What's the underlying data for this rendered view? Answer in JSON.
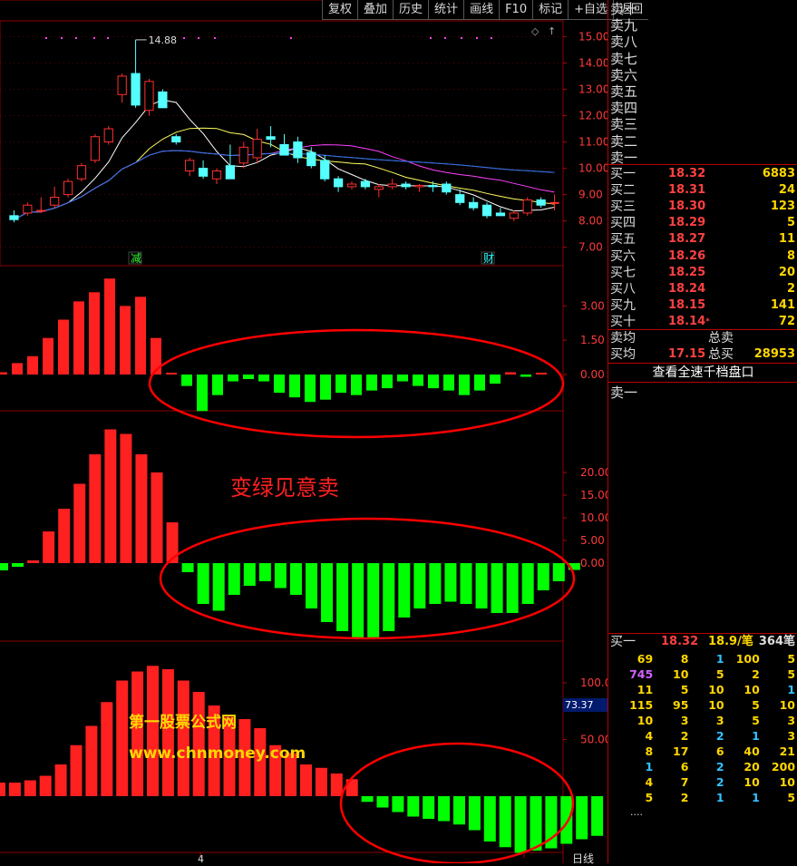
{
  "toolbar": {
    "items": [
      "复权",
      "叠加",
      "历史",
      "统计",
      "画线",
      "F10",
      "标记",
      "+自选",
      "返回"
    ]
  },
  "price_panel": {
    "high_label": "14.88",
    "y_ticks": [
      "15.00",
      "14.00",
      "13.00",
      "12.00",
      "11.00",
      "10.00",
      "9.00",
      "8.00",
      "7.00"
    ],
    "event_markers": [
      "减",
      "财"
    ]
  },
  "indicator1": {
    "y_ticks": [
      "3.00",
      "1.50",
      "0.00"
    ]
  },
  "indicator2": {
    "y_ticks": [
      "20.00",
      "15.00",
      "10.00",
      "5.00",
      "0.00"
    ],
    "annotation": "变绿见意卖"
  },
  "indicator3": {
    "y_ticks": [
      "100.0",
      "50.00"
    ],
    "current_value": "73.37"
  },
  "watermark": {
    "line1": "第一股票公式网",
    "line2": "www.chnmoney.com"
  },
  "x_axis": {
    "label": "4",
    "period": "日线"
  },
  "colors": {
    "up": "#ff2020",
    "down": "#00ff00",
    "up_candle": "#ff3030",
    "down_candle": "#55ffff",
    "circle": "#ff0000",
    "grid": "#8b0000"
  },
  "order_book": {
    "asks": [
      "卖十",
      "卖九",
      "卖八",
      "卖七",
      "卖六",
      "卖五",
      "卖四",
      "卖三",
      "卖二",
      "卖一"
    ],
    "bids": [
      {
        "label": "买一",
        "price": "18.32",
        "vol": "6883"
      },
      {
        "label": "买二",
        "price": "18.31",
        "vol": "24"
      },
      {
        "label": "买三",
        "price": "18.30",
        "vol": "123"
      },
      {
        "label": "买四",
        "price": "18.29",
        "vol": "5"
      },
      {
        "label": "买五",
        "price": "18.27",
        "vol": "11"
      },
      {
        "label": "买六",
        "price": "18.26",
        "vol": "8"
      },
      {
        "label": "买七",
        "price": "18.25",
        "vol": "20"
      },
      {
        "label": "买八",
        "price": "18.24",
        "vol": "2"
      },
      {
        "label": "买九",
        "price": "18.15",
        "vol": "141"
      },
      {
        "label": "买十",
        "price": "18.14",
        "vol": "72",
        "flag": "*"
      }
    ],
    "sell_avg_label": "卖均",
    "sell_total_label": "总卖",
    "buy_avg_label": "买均",
    "buy_avg": "17.15",
    "buy_total_label": "总买",
    "buy_total": "28953",
    "full_depth_button": "查看全速千档盘口",
    "level1_label": "卖一"
  },
  "tick_queue": {
    "label": "买一",
    "price": "18.32",
    "per_trade": "18.9/笔",
    "count": "364笔",
    "rows": [
      [
        "69",
        "8",
        "1",
        "100",
        "5"
      ],
      [
        "745",
        "10",
        "5",
        "2",
        "5"
      ],
      [
        "11",
        "5",
        "10",
        "10",
        "1"
      ],
      [
        "115",
        "95",
        "10",
        "5",
        "10"
      ],
      [
        "10",
        "3",
        "3",
        "5",
        "3"
      ],
      [
        "4",
        "2",
        "2",
        "1",
        "3"
      ],
      [
        "8",
        "17",
        "6",
        "40",
        "21"
      ],
      [
        "1",
        "6",
        "2",
        "20",
        "200"
      ],
      [
        "4",
        "7",
        "2",
        "10",
        "10"
      ],
      [
        "5",
        "2",
        "1",
        "1",
        "5"
      ]
    ],
    "ellipsis": "...."
  },
  "chart_data": [
    {
      "type": "candlestick",
      "ylim": [
        6.3,
        15.6
      ],
      "ohlc": [
        [
          8.2,
          8.4,
          7.95,
          8.05
        ],
        [
          8.3,
          8.7,
          8.2,
          8.6
        ],
        [
          8.4,
          8.9,
          8.3,
          8.4
        ],
        [
          8.6,
          9.3,
          8.5,
          8.9
        ],
        [
          9.0,
          9.6,
          8.9,
          9.5
        ],
        [
          9.6,
          10.2,
          9.5,
          10.1
        ],
        [
          10.3,
          11.3,
          10.2,
          11.2
        ],
        [
          11.0,
          11.6,
          10.9,
          11.5
        ],
        [
          12.8,
          13.6,
          12.5,
          13.5
        ],
        [
          13.6,
          14.88,
          12.3,
          12.4
        ],
        [
          12.2,
          13.4,
          12.0,
          13.3
        ],
        [
          12.9,
          13.0,
          12.3,
          12.3
        ],
        [
          11.2,
          11.3,
          10.9,
          11.0
        ],
        [
          9.9,
          10.4,
          9.7,
          10.3
        ],
        [
          10.0,
          10.3,
          9.6,
          9.7
        ],
        [
          9.6,
          10.0,
          9.4,
          9.9
        ],
        [
          10.1,
          10.9,
          9.8,
          9.6
        ],
        [
          10.2,
          11.0,
          10.0,
          10.8
        ],
        [
          10.4,
          11.5,
          10.2,
          11.1
        ],
        [
          11.2,
          11.6,
          10.8,
          11.1
        ],
        [
          10.9,
          11.3,
          10.5,
          10.5
        ],
        [
          11.0,
          11.2,
          10.2,
          10.4
        ],
        [
          10.6,
          10.8,
          10.0,
          10.1
        ],
        [
          10.3,
          10.5,
          9.5,
          9.6
        ],
        [
          9.6,
          9.7,
          9.1,
          9.3
        ],
        [
          9.3,
          9.5,
          9.2,
          9.4
        ],
        [
          9.5,
          9.6,
          9.2,
          9.3
        ],
        [
          9.2,
          9.4,
          8.9,
          9.3
        ],
        [
          9.3,
          9.6,
          9.2,
          9.4
        ],
        [
          9.4,
          9.5,
          9.2,
          9.3
        ],
        [
          9.3,
          9.4,
          9.1,
          9.35
        ],
        [
          9.35,
          9.5,
          9.1,
          9.3
        ],
        [
          9.4,
          9.5,
          9.0,
          9.1
        ],
        [
          9.0,
          9.2,
          8.6,
          8.7
        ],
        [
          8.7,
          8.9,
          8.4,
          8.5
        ],
        [
          8.6,
          8.7,
          8.1,
          8.2
        ],
        [
          8.3,
          8.5,
          8.2,
          8.2
        ],
        [
          8.1,
          8.4,
          8.0,
          8.3
        ],
        [
          8.3,
          8.9,
          8.2,
          8.8
        ],
        [
          8.8,
          8.9,
          8.5,
          8.6
        ],
        [
          8.7,
          9.0,
          8.4,
          8.7
        ]
      ]
    },
    {
      "type": "bar",
      "values": [
        0.1,
        0.5,
        0.8,
        1.6,
        2.4,
        3.2,
        3.6,
        4.2,
        3.0,
        3.4,
        1.6,
        0.0,
        -0.5,
        -1.6,
        -0.9,
        -0.3,
        -0.2,
        -0.3,
        -0.8,
        -1.0,
        -1.2,
        -1.1,
        -0.8,
        -0.9,
        -0.7,
        -0.6,
        -0.3,
        -0.5,
        -0.6,
        -0.7,
        -0.9,
        -0.7,
        -0.4,
        0.1,
        -0.1,
        0.0
      ]
    },
    {
      "type": "bar",
      "values": [
        -1.6,
        -0.8,
        0.6,
        7.0,
        12.0,
        17.5,
        24.0,
        29.5,
        28.5,
        24.0,
        20.0,
        9.0,
        -2.0,
        -9.0,
        -10.5,
        -7.0,
        -5.0,
        -4.0,
        -5.5,
        -7.0,
        -10.0,
        -13.0,
        -15.0,
        -16.5,
        -16.5,
        -15.0,
        -12.0,
        -10.0,
        -9.0,
        -8.5,
        -9.0,
        -10.0,
        -11.0,
        -11.0,
        -9.0,
        -6.0,
        -4.0,
        -1.5
      ]
    },
    {
      "type": "bar",
      "values": [
        12,
        12,
        14,
        18,
        28,
        45,
        62,
        83,
        102,
        110,
        115,
        112,
        102,
        92,
        80,
        70,
        68,
        60,
        45,
        38,
        28,
        25,
        20,
        15,
        -5,
        -10,
        -14,
        -18,
        -20,
        -22,
        -25,
        -30,
        -40,
        -45,
        -50,
        -48,
        -46,
        -42,
        -38,
        -35
      ]
    }
  ]
}
